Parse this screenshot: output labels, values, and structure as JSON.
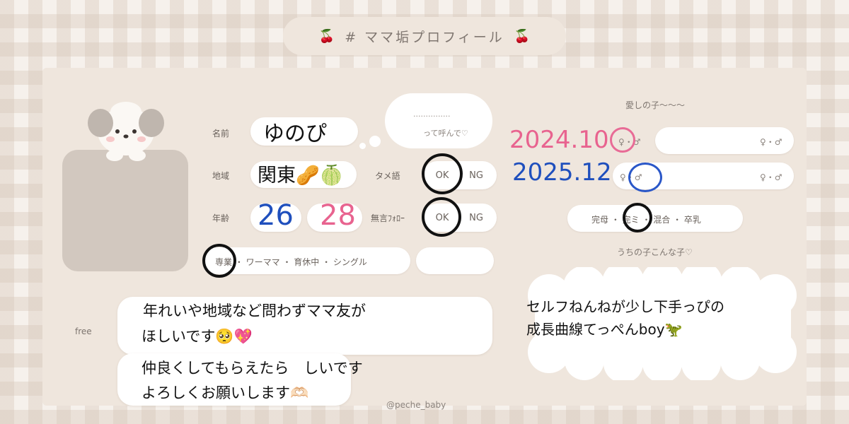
{
  "title": {
    "text": "# ママ垢プロフィール",
    "left_icon": "cherry-icon",
    "right_icon": "cherry-icon",
    "left_glyph": "🍒",
    "right_glyph": "🍒"
  },
  "profile": {
    "name_label": "名前",
    "name_value": "ゆのぴ",
    "nickname_dots": "···············",
    "nickname_hint": "って呼んで♡",
    "region_label": "地域",
    "region_value": "関東🥜🍈",
    "age_label": "年齢",
    "age_value_1": "26",
    "age_value_2": "28",
    "tame_label": "タメ語",
    "tame_ok": "OK",
    "tame_ng": "NG",
    "follow_label": "無言ﾌｫﾛｰ",
    "follow_ok": "OK",
    "follow_ng": "NG",
    "role_options": "専業 ・ ワーママ ・ 育休中 ・ シングル",
    "role_first": "専業"
  },
  "children": {
    "heading": "愛しの子〜〜〜",
    "child1_date": "2024.10",
    "child1_sex": "♀・♂",
    "child2_date": "2025.12",
    "child2_sex": "♀・♂",
    "extra_sex_1": "♀・♂",
    "extra_sex_2": "♀・♂",
    "feeding_options": "完母 ・ 完ミ ・ 混合 ・ 卒乳",
    "about_heading": "うちの子こんな子♡",
    "about_text_line1": "セルフねんねが少し下手っぴの",
    "about_text_line2": "成長曲線てっぺんboy🦖"
  },
  "free": {
    "label": "free",
    "line1": "年れいや地域など問わずママ友が",
    "line2": "ほしいです🥺💖",
    "line3": "仲良くしてもらえたら　しいです",
    "line4": "よろしくお願いします🫶🏻"
  },
  "credit": "@peche_baby",
  "colors": {
    "pink": "#e8638f",
    "blue": "#1f4fbd",
    "pink_circle": "#e86b96",
    "blue_circle": "#2a57c8",
    "black_circle": "#111111"
  }
}
